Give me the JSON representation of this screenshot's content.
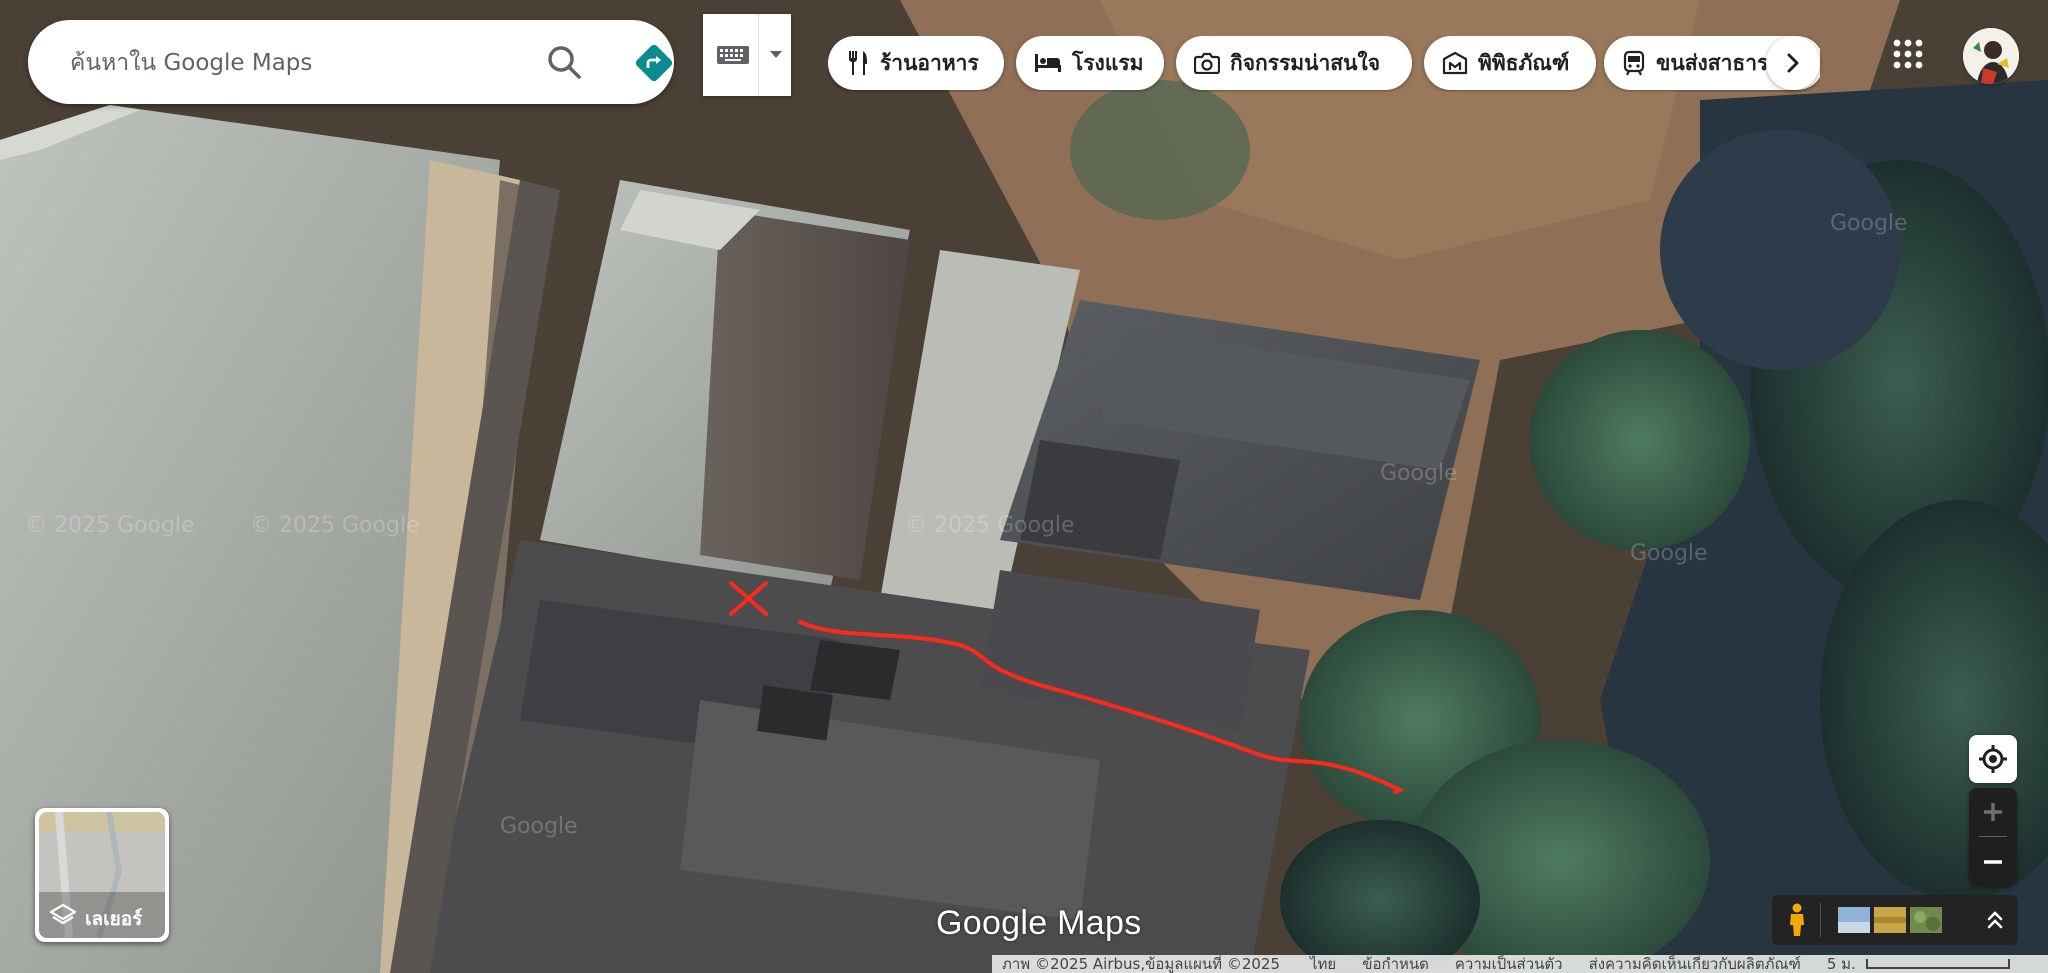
{
  "search": {
    "placeholder": "ค้นหาใน Google Maps"
  },
  "chips": [
    {
      "label": "ร้านอาหาร",
      "icon": "restaurant-icon"
    },
    {
      "label": "โรงแรม",
      "icon": "hotel-icon"
    },
    {
      "label": "กิจกรรมน่าสนใจ",
      "icon": "camera-icon"
    },
    {
      "label": "พิพิธภัณฑ์",
      "icon": "museum-icon"
    },
    {
      "label": "ขนส่งสาธารณะ",
      "icon": "transit-icon"
    }
  ],
  "layers": {
    "label": "เลเยอร์"
  },
  "logo": {
    "text": "Google Maps"
  },
  "watermarks": [
    "© 2025 Google",
    "© 2025 Google",
    "© 2025 Google",
    "Google",
    "Google",
    "Google",
    "Google"
  ],
  "footer": {
    "imagery": "ภาพ ©2025 Airbus,ข้อมูลแผนที่ ©2025",
    "language": "ไทย",
    "terms": "ข้อกำหนด",
    "privacy": "ความเป็นส่วนตัว",
    "feedback": "ส่งความคิดเห็นเกี่ยวกับผลิตภัณฑ์",
    "scale": "5 ม."
  },
  "colors": {
    "accent": "#1a73e8",
    "directions": "#0b8a8f",
    "route": "#ff2a1a",
    "zoom_bg": "#1f1f1f"
  }
}
